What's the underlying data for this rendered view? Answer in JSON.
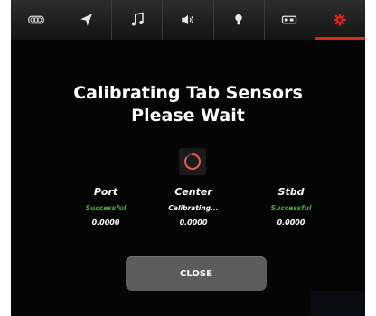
{
  "nav": {
    "tabs": [
      {
        "icon": "gauge-icon",
        "active": false
      },
      {
        "icon": "navigation-arrow-icon",
        "active": false
      },
      {
        "icon": "music-note-icon",
        "active": false
      },
      {
        "icon": "speaker-icon",
        "active": false
      },
      {
        "icon": "light-bulb-icon",
        "active": false
      },
      {
        "icon": "battery-icon",
        "active": false
      },
      {
        "icon": "gear-icon",
        "active": true
      }
    ],
    "accent_color": "#e0251b"
  },
  "dialog": {
    "title_line1": "Calibrating Tab Sensors",
    "title_line2": "Please Wait",
    "sensors": [
      {
        "name": "Port",
        "status": "Successful",
        "value": "0.0000",
        "status_color": "#3fae35"
      },
      {
        "name": "Center",
        "status": "Calibrating...",
        "value": "0.0000",
        "status_color": "#ffffff"
      },
      {
        "name": "Stbd",
        "status": "Successful",
        "value": "0.0000",
        "status_color": "#3fae35"
      }
    ],
    "close_label": "CLOSE"
  }
}
